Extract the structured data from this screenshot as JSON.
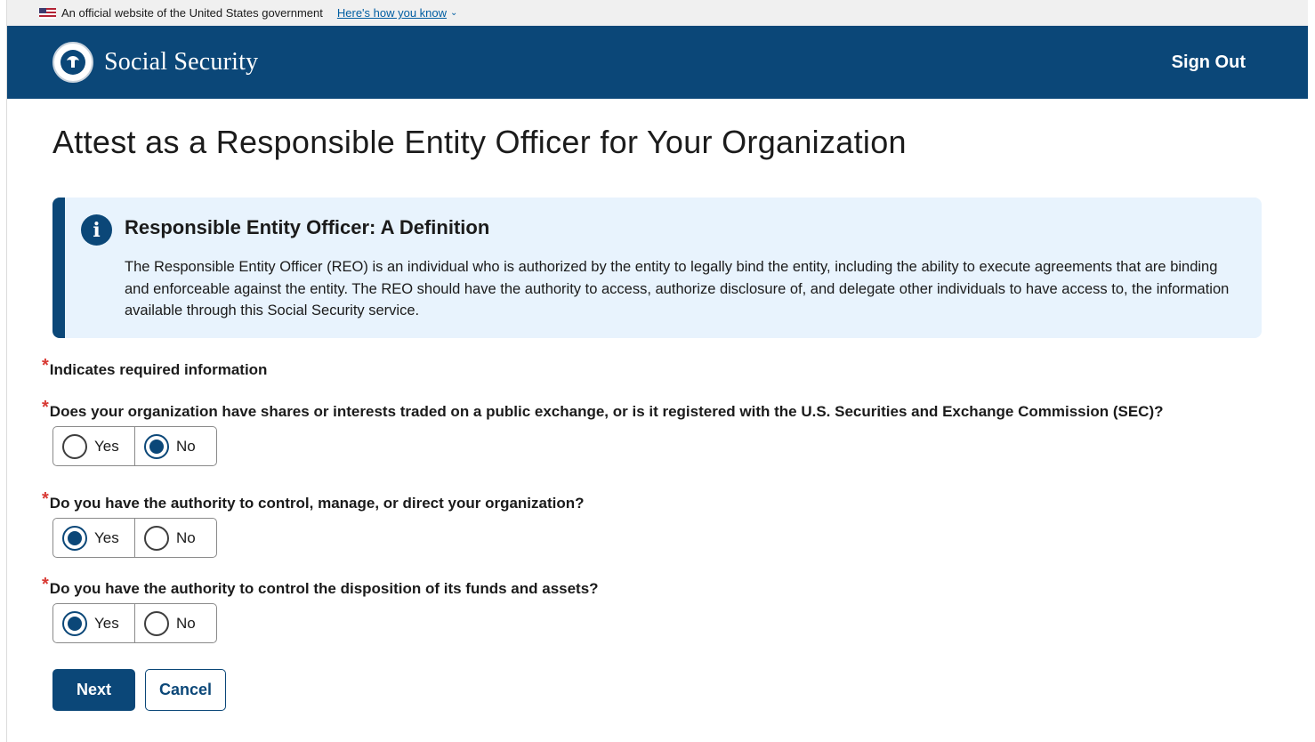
{
  "gov_banner": {
    "text": "An official website of the United States government",
    "link": "Here's how you know",
    "chevron": "⌄"
  },
  "header": {
    "brand": "Social Security",
    "sign_out": "Sign Out",
    "logo_icon": "ssa-seal-icon"
  },
  "page_title": "Attest as a Responsible Entity Officer for Your Organization",
  "alert": {
    "icon": "info-icon",
    "icon_glyph": "i",
    "heading": "Responsible Entity Officer: A Definition",
    "body": "The Responsible Entity Officer (REO) is an individual who is authorized by the entity to legally bind the entity, including the ability to execute agreements that are binding and enforceable against the entity. The REO should have the authority to access, authorize disclosure of, and delegate other individuals to have access to, the information available through this Social Security service."
  },
  "form": {
    "required_mark": "*",
    "required_note": "Indicates required information",
    "questions": [
      {
        "text": "Does your organization have shares or interests traded on a public exchange, or is it registered with the U.S. Securities and Exchange Commission (SEC)?",
        "options": [
          "Yes",
          "No"
        ],
        "selected": "No"
      },
      {
        "text": "Do you have the authority to control, manage, or direct your organization?",
        "options": [
          "Yes",
          "No"
        ],
        "selected": "Yes"
      },
      {
        "text": "Do you have the authority to control the disposition of its funds and assets?",
        "options": [
          "Yes",
          "No"
        ],
        "selected": "Yes"
      }
    ],
    "next_label": "Next",
    "cancel_label": "Cancel"
  },
  "colors": {
    "header_bg": "#0b4778",
    "alert_bg": "#e8f3fd",
    "required": "#d83933",
    "link": "#005ea2"
  }
}
